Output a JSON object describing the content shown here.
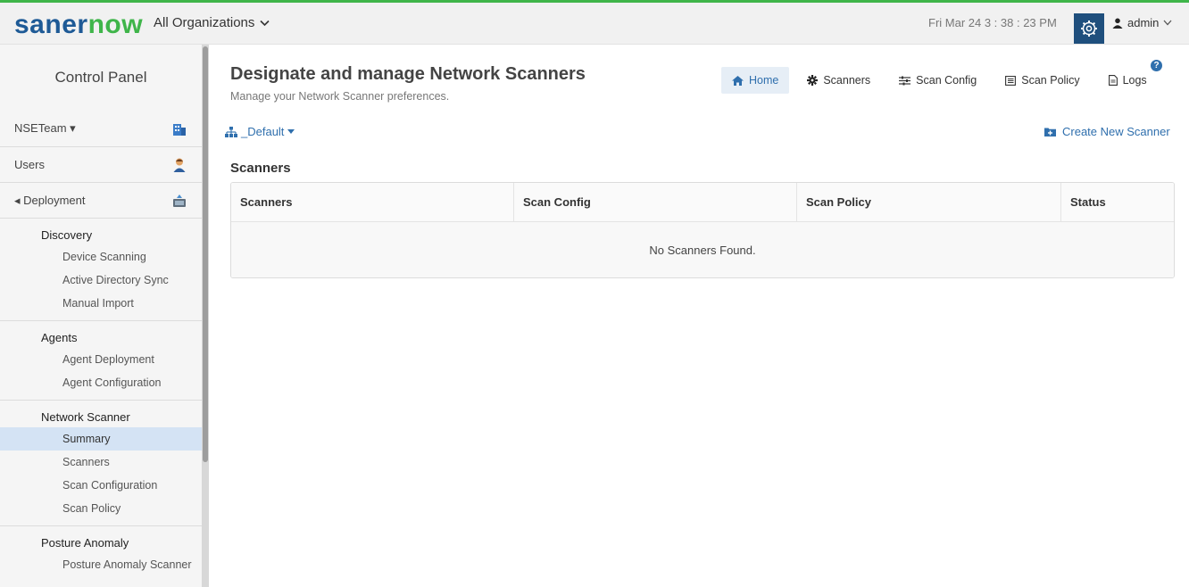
{
  "header": {
    "logo_main": "saner",
    "logo_accent": "now",
    "org_label": "All Organizations",
    "datetime": "Fri Mar 24  3 : 38 : 23 PM",
    "user": "admin"
  },
  "sidebar": {
    "title": "Control Panel",
    "rows": [
      {
        "label": "NSETeam ▾",
        "icon": "building-icon"
      },
      {
        "label": "Users",
        "icon": "user-icon"
      },
      {
        "label": "◂ Deployment",
        "icon": "deploy-icon"
      }
    ],
    "groups": [
      {
        "title": "Discovery",
        "items": [
          "Device Scanning",
          "Active Directory Sync",
          "Manual Import"
        ]
      },
      {
        "title": "Agents",
        "items": [
          "Agent Deployment",
          "Agent Configuration"
        ]
      },
      {
        "title": "Network Scanner",
        "items": [
          "Summary",
          "Scanners",
          "Scan Configuration",
          "Scan Policy"
        ]
      },
      {
        "title": "Posture Anomaly",
        "items": [
          "Posture Anomaly Scanner"
        ]
      }
    ],
    "active_item": "Summary"
  },
  "main": {
    "title": "Designate and manage Network Scanners",
    "subtitle": "Manage your Network Scanner preferences.",
    "tabs": [
      {
        "label": "Home",
        "icon": "home-icon",
        "active": true
      },
      {
        "label": "Scanners",
        "icon": "gear-icon",
        "active": false
      },
      {
        "label": "Scan Config",
        "icon": "sliders-icon",
        "active": false
      },
      {
        "label": "Scan Policy",
        "icon": "list-icon",
        "active": false
      },
      {
        "label": "Logs",
        "icon": "document-icon",
        "active": false
      }
    ],
    "scope": "_Default",
    "create_label": "Create New Scanner",
    "section_title": "Scanners",
    "table": {
      "columns": [
        "Scanners",
        "Scan Config",
        "Scan Policy",
        "Status"
      ],
      "empty_text": "No Scanners Found."
    }
  },
  "colors": {
    "brand_blue": "#1e5a96",
    "brand_green": "#3fb54a",
    "link_blue": "#2f6fad"
  }
}
